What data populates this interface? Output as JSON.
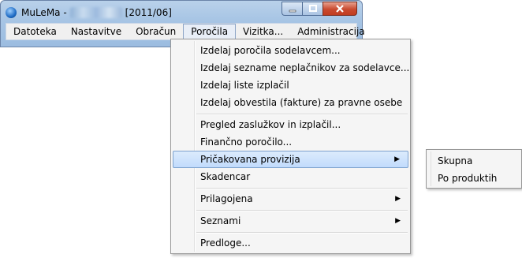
{
  "window": {
    "app_name": "MuLeMa -",
    "period": "[2011/06]",
    "buttons": {
      "minimize": "minimize-icon",
      "maximize": "maximize-icon",
      "close": "close-icon"
    }
  },
  "menubar": {
    "items": [
      "Datoteka",
      "Nastavitve",
      "Obračun",
      "Poročila",
      "Vizitka...",
      "Administracija"
    ],
    "active": "Poročila"
  },
  "dropdown": {
    "items": [
      {
        "label": "Izdelaj poročila sodelavcem..."
      },
      {
        "label": "Izdelaj sezname neplačnikov za sodelavce..."
      },
      {
        "label": "Izdelaj liste izplačil"
      },
      {
        "label": "Izdelaj obvestila (fakture) za pravne osebe"
      },
      {
        "label": "Pregled zaslužkov in izplačil..."
      },
      {
        "label": "Finančno poročilo..."
      },
      {
        "label": "Pričakovana provizija",
        "submenu": true,
        "highlighted": true
      },
      {
        "label": "Skadencar"
      },
      {
        "label": "Prilagojena",
        "submenu": true
      },
      {
        "label": "Seznami",
        "submenu": true
      },
      {
        "label": "Predloge..."
      }
    ]
  },
  "submenu": {
    "items": [
      "Skupna",
      "Po produktih"
    ]
  }
}
